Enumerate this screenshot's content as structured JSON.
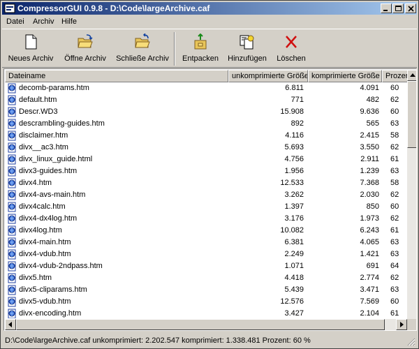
{
  "window": {
    "title": "CompressorGUI 0.9.8 - D:\\Code\\largeArchive.caf"
  },
  "menu": [
    {
      "label": "Datei"
    },
    {
      "label": "Archiv"
    },
    {
      "label": "Hilfe"
    }
  ],
  "toolbar": {
    "new_archive": "Neues Archiv",
    "open_archive": "Öffne Archiv",
    "close_archive": "Schließe Archiv",
    "extract": "Entpacken",
    "add": "Hinzufügen",
    "delete": "Löschen"
  },
  "columns": {
    "name": "Dateiname",
    "uncompressed": "unkomprimierte Größe",
    "compressed": "komprimierte Größe",
    "percent": "Prozent"
  },
  "files": [
    {
      "name": "decomb-params.htm",
      "uncompressed": "6.811",
      "compressed": "4.091",
      "percent": "60"
    },
    {
      "name": "default.htm",
      "uncompressed": "771",
      "compressed": "482",
      "percent": "62"
    },
    {
      "name": "Descr.WD3",
      "uncompressed": "15.908",
      "compressed": "9.636",
      "percent": "60"
    },
    {
      "name": "descrambling-guides.htm",
      "uncompressed": "892",
      "compressed": "565",
      "percent": "63"
    },
    {
      "name": "disclaimer.htm",
      "uncompressed": "4.116",
      "compressed": "2.415",
      "percent": "58"
    },
    {
      "name": "divx__ac3.htm",
      "uncompressed": "5.693",
      "compressed": "3.550",
      "percent": "62"
    },
    {
      "name": "divx_linux_guide.html",
      "uncompressed": "4.756",
      "compressed": "2.911",
      "percent": "61"
    },
    {
      "name": "divx3-guides.htm",
      "uncompressed": "1.956",
      "compressed": "1.239",
      "percent": "63"
    },
    {
      "name": "divx4.htm",
      "uncompressed": "12.533",
      "compressed": "7.368",
      "percent": "58"
    },
    {
      "name": "divx4-avs-main.htm",
      "uncompressed": "3.262",
      "compressed": "2.030",
      "percent": "62"
    },
    {
      "name": "divx4calc.htm",
      "uncompressed": "1.397",
      "compressed": "850",
      "percent": "60"
    },
    {
      "name": "divx4-dx4log.htm",
      "uncompressed": "3.176",
      "compressed": "1.973",
      "percent": "62"
    },
    {
      "name": "divx4log.htm",
      "uncompressed": "10.082",
      "compressed": "6.243",
      "percent": "61"
    },
    {
      "name": "divx4-main.htm",
      "uncompressed": "6.381",
      "compressed": "4.065",
      "percent": "63"
    },
    {
      "name": "divx4-vdub.htm",
      "uncompressed": "2.249",
      "compressed": "1.421",
      "percent": "63"
    },
    {
      "name": "divx4-vdub-2ndpass.htm",
      "uncompressed": "1.071",
      "compressed": "691",
      "percent": "64"
    },
    {
      "name": "divx5.htm",
      "uncompressed": "4.418",
      "compressed": "2.774",
      "percent": "62"
    },
    {
      "name": "divx5-cliparams.htm",
      "uncompressed": "5.439",
      "compressed": "3.471",
      "percent": "63"
    },
    {
      "name": "divx5-vdub.htm",
      "uncompressed": "12.576",
      "compressed": "7.569",
      "percent": "60"
    },
    {
      "name": "divx-encoding.htm",
      "uncompressed": "3.427",
      "compressed": "2.104",
      "percent": "61"
    }
  ],
  "status": {
    "text": "D:\\Code\\largeArchive.caf   unkomprimiert: 2.202.547   komprimiert: 1.338.481   Prozent: 60 %"
  }
}
